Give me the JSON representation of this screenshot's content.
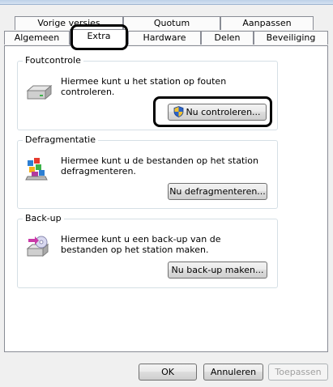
{
  "tabs_row1": [
    {
      "label": "Vorige versies"
    },
    {
      "label": "Quotum"
    },
    {
      "label": "Aanpassen"
    }
  ],
  "tabs_row2": [
    {
      "label": "Algemeen"
    },
    {
      "label": "Extra",
      "selected": true
    },
    {
      "label": "Hardware"
    },
    {
      "label": "Delen"
    },
    {
      "label": "Beveiliging"
    }
  ],
  "groups": {
    "error_check": {
      "title": "Foutcontrole",
      "text": "Hiermee kunt u het station op fouten controleren.",
      "button": "Nu controleren...",
      "icon": "drive-icon"
    },
    "defrag": {
      "title": "Defragmentatie",
      "text": "Hiermee kunt u de bestanden op het station defragmenteren.",
      "button": "Nu defragmenteren...",
      "icon": "defrag-icon"
    },
    "backup": {
      "title": "Back-up",
      "text": "Hiermee kunt u een back-up van de bestanden op het station maken.",
      "button": "Nu back-up maken...",
      "icon": "backup-icon"
    }
  },
  "footer": {
    "ok": "OK",
    "cancel": "Annuleren",
    "apply": "Toepassen"
  }
}
